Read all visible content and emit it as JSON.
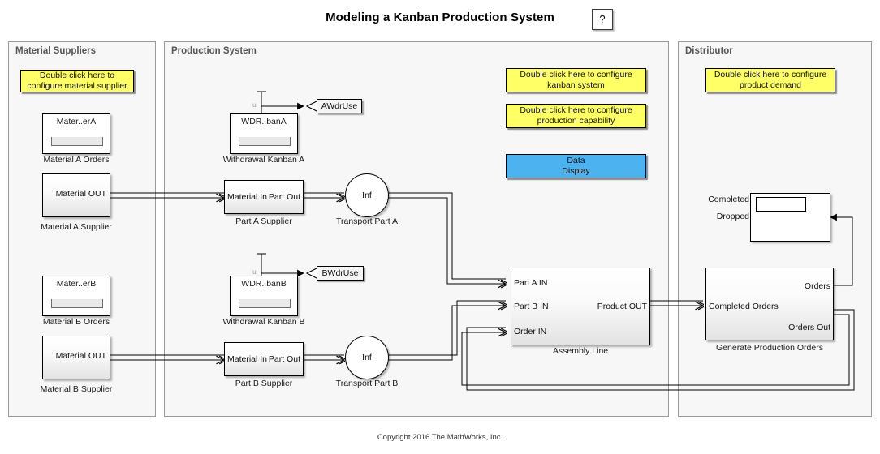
{
  "page": {
    "title": "Modeling a Kanban Production System",
    "help_label": "?",
    "copyright": "Copyright 2016 The MathWorks, Inc."
  },
  "panels": {
    "material_suppliers": {
      "title": "Material Suppliers"
    },
    "production_system": {
      "title": "Production System"
    },
    "distributor": {
      "title": "Distributor"
    }
  },
  "notes": {
    "material_supplier": "Double click here to\nconfigure material supplier",
    "kanban_system": "Double click here to configure\nkanban system",
    "production_capability": "Double click here to configure\nproduction capability",
    "product_demand": "Double click here to configure\nproduct demand",
    "data_display": "Data\nDisplay"
  },
  "blocks": {
    "material_a_orders": {
      "inner_title": "Mater..erA",
      "caption": "Material A Orders"
    },
    "material_b_orders": {
      "inner_title": "Mater..erB",
      "caption": "Material B Orders"
    },
    "material_a_supplier": {
      "port_out": "Material OUT",
      "caption": "Material A Supplier"
    },
    "material_b_supplier": {
      "port_out": "Material OUT",
      "caption": "Material B Supplier"
    },
    "withdrawal_kanban_a": {
      "inner_title": "WDR..banA",
      "caption": "Withdrawal Kanban A",
      "signal_label": "u",
      "tag": "AWdrUse"
    },
    "withdrawal_kanban_b": {
      "inner_title": "WDR..banB",
      "caption": "Withdrawal Kanban B",
      "signal_label": "u",
      "tag": "BWdrUse"
    },
    "part_a_supplier": {
      "port_in": "Material In",
      "port_out": "Part Out",
      "caption": "Part A Supplier"
    },
    "part_b_supplier": {
      "port_in": "Material In",
      "port_out": "Part Out",
      "caption": "Part B Supplier"
    },
    "transport_part_a": {
      "value": "Inf",
      "caption": "Transport Part A"
    },
    "transport_part_b": {
      "value": "Inf",
      "caption": "Transport Part B"
    },
    "assembly_line": {
      "port_in_1": "Part A IN",
      "port_in_2": "Part B IN",
      "port_in_3": "Order IN",
      "port_out": "Product OUT",
      "caption": "Assembly Line"
    },
    "generate_production_orders": {
      "port_in": "Completed Orders",
      "port_out_1": "Orders",
      "port_out_2": "Orders Out",
      "caption": "Generate Production Orders"
    },
    "distributor_display": {
      "label_completed": "Completed",
      "label_dropped": "Dropped"
    }
  },
  "colors": {
    "note_yellow": "#ffff66",
    "note_blue": "#4db2f0",
    "panel_bg": "#f7f7f7",
    "panel_border": "#9a9a9a",
    "line": "#000000"
  }
}
